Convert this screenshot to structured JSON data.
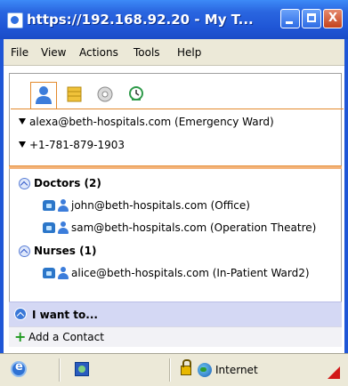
{
  "window": {
    "title": "https://192.168.92.20 - My T...",
    "controls": {
      "minimize": "",
      "maximize": "",
      "close": "X"
    }
  },
  "menubar": {
    "items": [
      "File",
      "View",
      "Actions",
      "Tools",
      "Help"
    ]
  },
  "tabs": [
    {
      "icon": "person-icon",
      "active": true
    },
    {
      "icon": "grid-icon",
      "active": false
    },
    {
      "icon": "disc-icon",
      "active": false
    },
    {
      "icon": "clock-icon",
      "active": false
    }
  ],
  "profile": {
    "identity": "alexa@beth-hospitals.com (Emergency Ward)",
    "phone": "+1-781-879-1903"
  },
  "groups": [
    {
      "title": "Doctors (2)",
      "contacts": [
        "john@beth-hospitals.com (Office)",
        "sam@beth-hospitals.com (Operation Theatre)"
      ]
    },
    {
      "title": "Nurses (1)",
      "contacts": [
        "alice@beth-hospitals.com (In-Patient Ward2)"
      ]
    }
  ],
  "actions": {
    "header": "I want to...",
    "add_contact": "Add a Contact"
  },
  "statusbar": {
    "zone": "Internet"
  },
  "colors": {
    "titlebar": "#2a66e0",
    "accent_orange": "#e38a2c",
    "action_bar": "#d4d8f4"
  }
}
